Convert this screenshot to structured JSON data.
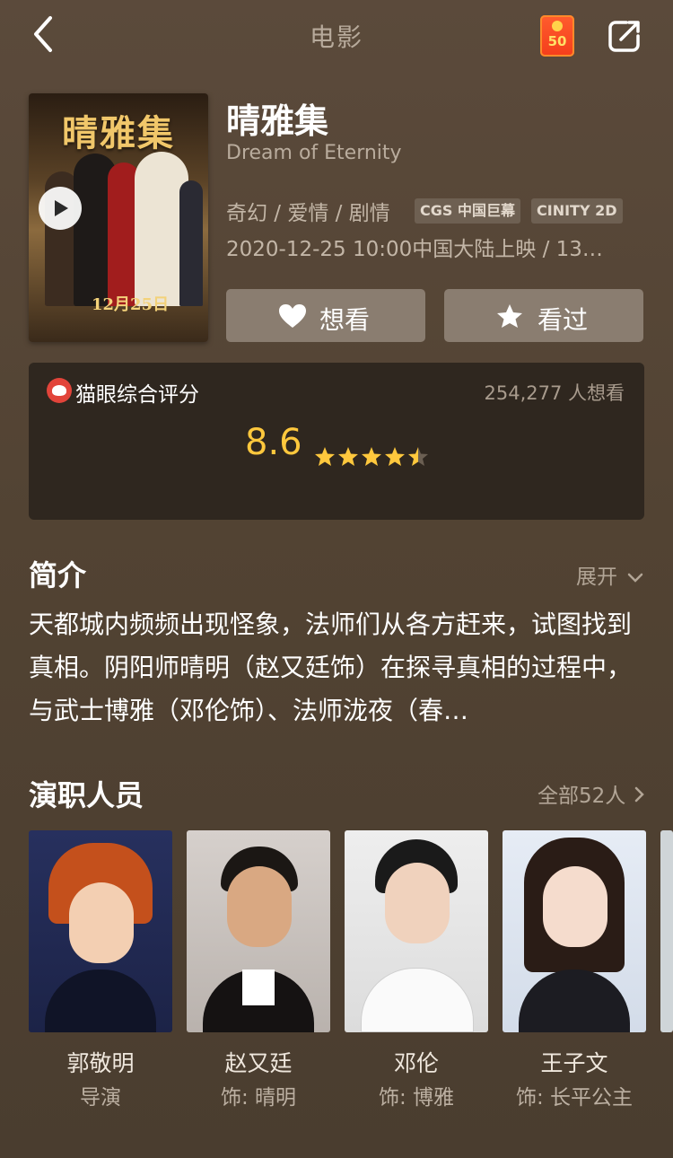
{
  "nav": {
    "title": "电影",
    "red_packet_amount": "50"
  },
  "movie": {
    "title": "晴雅集",
    "title_en": "Dream of Eternity",
    "genres": "奇幻 / 爱情 / 剧情",
    "tags": [
      "CGS 中国巨幕",
      "CINITY 2D"
    ],
    "release": "2020-12-25 10:00中国大陆上映 / 13…",
    "poster": {
      "title": "晴雅集",
      "date": "12月25日"
    }
  },
  "actions": {
    "want_label": "想看",
    "watched_label": "看过"
  },
  "rating": {
    "brand": "猫眼综合评分",
    "wants": "254,277 人想看",
    "score": "8.6",
    "stars": 4.5
  },
  "synopsis": {
    "heading": "简介",
    "expand_label": "展开",
    "text": "天都城内频频出现怪象，法师们从各方赶来，试图找到真相。阴阳师晴明（赵又廷饰）在探寻真相的过程中，与武士博雅（邓伦饰）、法师泷夜（春…"
  },
  "cast": {
    "heading": "演职人员",
    "all_label": "全部52人",
    "members": [
      {
        "name": "郭敬明",
        "role": "导演"
      },
      {
        "name": "赵又廷",
        "role": "饰: 晴明"
      },
      {
        "name": "邓伦",
        "role": "饰: 博雅"
      },
      {
        "name": "王子文",
        "role": "饰: 长平公主"
      }
    ]
  },
  "colors": {
    "background": "#524333",
    "score": "#ffc83d",
    "button": "#8a7d70",
    "card": "#2f271f",
    "brand_red": "#e2443a"
  }
}
